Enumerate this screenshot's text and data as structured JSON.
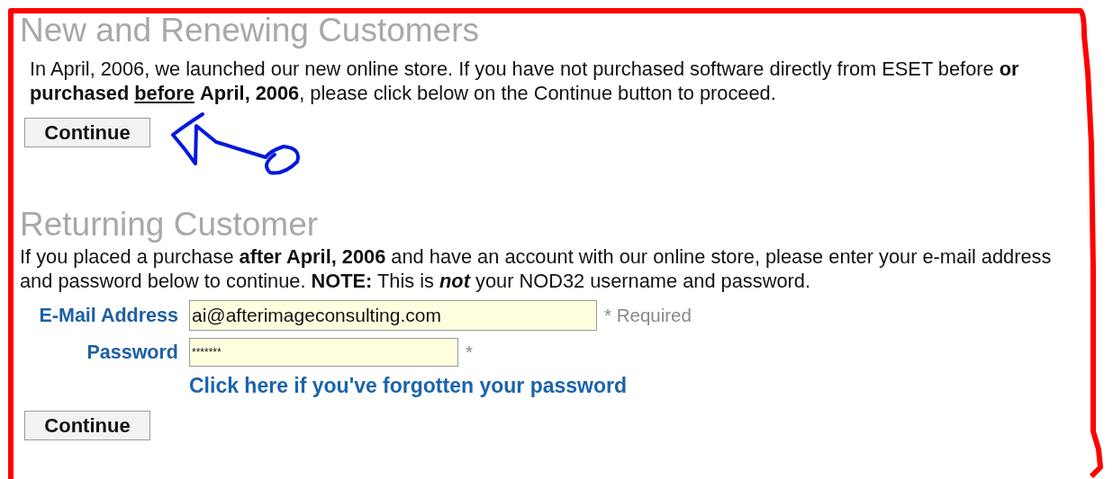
{
  "new_customers": {
    "heading": "New and Renewing Customers",
    "intro": [
      {
        "text": "In April, 2006, we launched our new online store. If you have not purchased software directly from ESET before **or purchased** ",
        "underlined": false
      },
      {
        "text": "**before**",
        "underlined": true
      },
      {
        "text": " **April, 2006**, please click below on the Continue button to proceed.",
        "underlined": false
      }
    ],
    "button": "Continue"
  },
  "returning_customer": {
    "heading": "Returning Customer",
    "intro": [
      {
        "text": "If you placed a purchase **after April, 2006** and have an account with our online store, please enter your e-mail address and password below to continue. **NOTE:** This is ",
        "italic": false
      },
      {
        "text": "**not**",
        "italic": true
      },
      {
        "text": " your NOD32 username and password.",
        "italic": false
      }
    ],
    "fields": [
      {
        "label": "E-Mail Address",
        "value": "ai@afterimageconsulting.com",
        "kind": "text",
        "note": "* Required"
      },
      {
        "label": "Password",
        "value": "*******",
        "kind": "password",
        "note": "*"
      }
    ],
    "forgot_link": "Click here if you've forgotten your password",
    "button": "Continue"
  }
}
